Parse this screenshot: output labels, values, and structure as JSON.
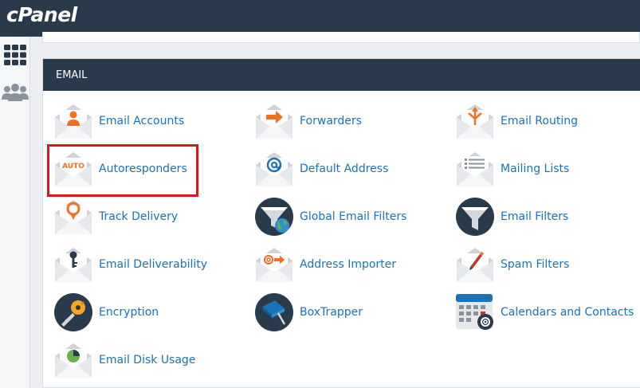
{
  "brand": {
    "logo_text": "cPanel"
  },
  "section": {
    "title": "EMAIL"
  },
  "colors": {
    "header_bg": "#293a4a",
    "link": "#1b72b7",
    "accent_orange": "#f37021",
    "highlight": "#e0141e"
  },
  "sidebar": {
    "items": [
      {
        "icon": "grid-icon"
      },
      {
        "icon": "users-icon"
      }
    ]
  },
  "email_tools": [
    {
      "label": "Email Accounts",
      "icon": "email-accounts-icon"
    },
    {
      "label": "Forwarders",
      "icon": "forwarders-icon"
    },
    {
      "label": "Email Routing",
      "icon": "email-routing-icon"
    },
    {
      "label": "Autoresponders",
      "icon": "autoresponders-icon",
      "icon_text": "AUTO",
      "highlighted": true
    },
    {
      "label": "Default Address",
      "icon": "default-address-icon"
    },
    {
      "label": "Mailing Lists",
      "icon": "mailing-lists-icon"
    },
    {
      "label": "Track Delivery",
      "icon": "track-delivery-icon"
    },
    {
      "label": "Global Email Filters",
      "icon": "global-email-filters-icon"
    },
    {
      "label": "Email Filters",
      "icon": "email-filters-icon"
    },
    {
      "label": "Email Deliverability",
      "icon": "email-deliverability-icon"
    },
    {
      "label": "Address Importer",
      "icon": "address-importer-icon"
    },
    {
      "label": "Spam Filters",
      "icon": "spam-filters-icon"
    },
    {
      "label": "Encryption",
      "icon": "encryption-icon"
    },
    {
      "label": "BoxTrapper",
      "icon": "boxtrapper-icon"
    },
    {
      "label": "Calendars and Contacts",
      "icon": "calendars-contacts-icon"
    },
    {
      "label": "Email Disk Usage",
      "icon": "email-disk-usage-icon"
    }
  ]
}
